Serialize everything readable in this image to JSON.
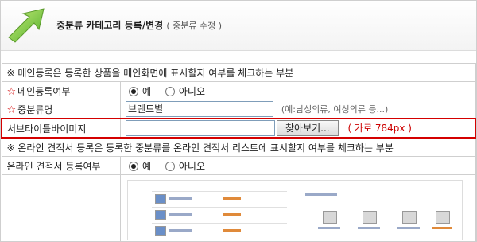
{
  "header": {
    "title": "중분류 카테고리 등록/변경",
    "subtitle": "( 중분류 수정 )"
  },
  "notices": {
    "main_display": "※ 메인등록은 등록한 상품을 메인화면에 표시할지 여부를 체크하는 부분",
    "online_quote": "※ 온라인 견적서 등록은 등록한 중분류를 온라인 견적서 리스트에 표시할지 여부를 체크하는 부분"
  },
  "rows": {
    "main_register": {
      "star": "☆",
      "label": "메인등록여부",
      "option_yes": "예",
      "option_no": "아니오"
    },
    "subcategory_name": {
      "star": "☆",
      "label": "중분류명",
      "value": "브랜드별",
      "hint": "(예:남성의류, 여성의류 등...)"
    },
    "subtitle_image": {
      "label": "서브타이틀바이미지",
      "browse": "찾아보기...",
      "size_hint": "( 가로 784px )"
    },
    "online_quote": {
      "label": "온라인 견적서 등록여부",
      "option_yes": "예",
      "option_no": "아니오"
    }
  },
  "colors": {
    "highlight": "#d40000",
    "arrow": "#7ac943"
  }
}
